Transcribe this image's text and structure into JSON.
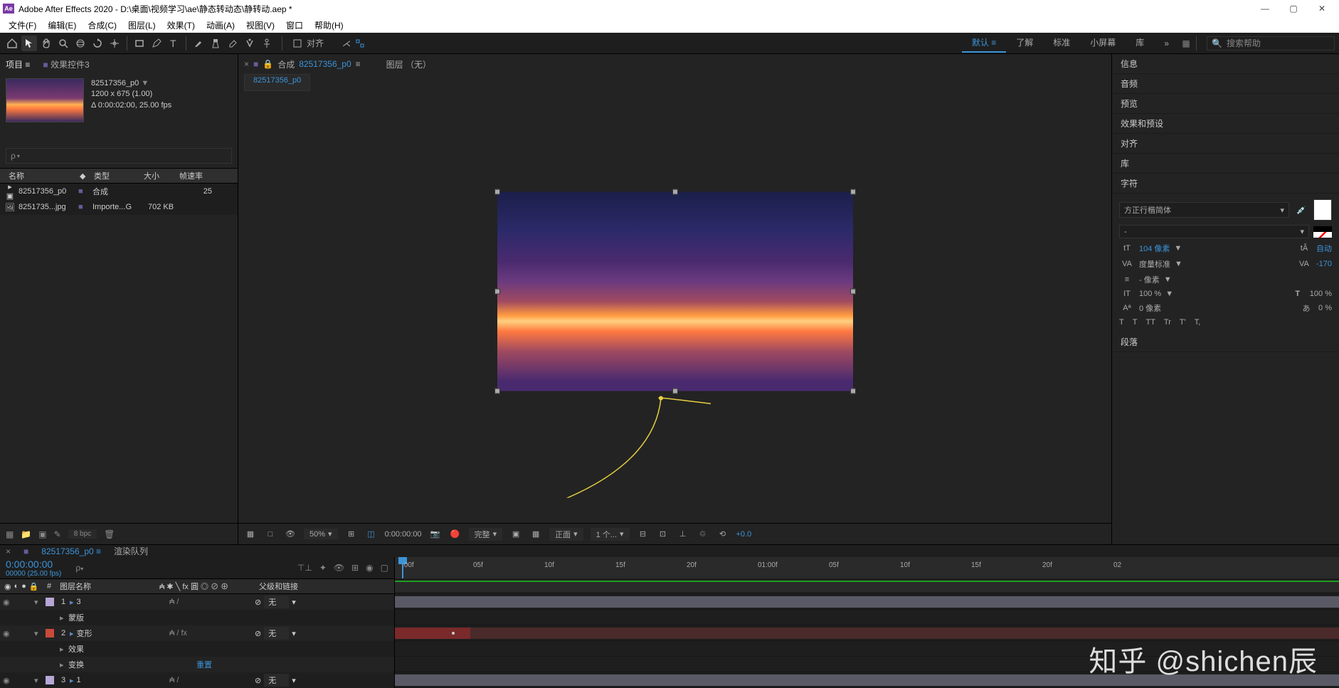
{
  "titlebar": {
    "logo": "Ae",
    "title": "Adobe After Effects 2020 - D:\\桌面\\视频学习\\ae\\静态转动态\\静转动.aep *"
  },
  "menubar": [
    "文件(F)",
    "编辑(E)",
    "合成(C)",
    "图层(L)",
    "效果(T)",
    "动画(A)",
    "视图(V)",
    "窗口",
    "帮助(H)"
  ],
  "toolbar": {
    "align_label": "对齐"
  },
  "workspaces": {
    "items": [
      "默认",
      "了解",
      "标准",
      "小屏幕",
      "库"
    ],
    "active": "默认",
    "more": "»",
    "search_placeholder": "搜索帮助"
  },
  "project": {
    "tab_project": "项目",
    "tab_effects": "效果控件3",
    "menu_glyph": "≡",
    "link_glyph": "■",
    "selected": {
      "name": "82517356_p0",
      "dims": "1200 x 675 (1.00)",
      "duration": "Δ 0:00:02:00, 25.00 fps"
    },
    "columns": {
      "name": "名称",
      "tag": "◆",
      "type": "类型",
      "size": "大小",
      "fps": "帧速率"
    },
    "rows": [
      {
        "name": "82517356_p0",
        "type": "合成",
        "size": "",
        "fps": "25"
      },
      {
        "name": "8251735...jpg",
        "type": "Importe...G",
        "size": "702 KB",
        "fps": ""
      }
    ],
    "footer": {
      "bpc": "8 bpc"
    }
  },
  "composition": {
    "tab_prefix": "合成",
    "tab_name": "82517356_p0",
    "menu_glyph": "≡",
    "layer_none": "图层 （无）",
    "subtab": "82517356_p0"
  },
  "viewer_footer": {
    "zoom": "50%",
    "timecode": "0:00:00:00",
    "res": "完整",
    "view": "正面",
    "views": "1 个...",
    "exposure": "+0.0"
  },
  "right": {
    "panels": [
      "信息",
      "音频",
      "预览",
      "效果和预设",
      "对齐",
      "库",
      "字符",
      "段落"
    ],
    "char": {
      "font": "方正行楷简体",
      "style": "-",
      "size_ic": "tT",
      "size": "104 像素",
      "size_arrow": "▼",
      "leading_ic": "tÂ",
      "leading": "自动",
      "kerning_ic": "VA",
      "kerning": "度量标准",
      "kerning_arrow": "▼",
      "tracking_ic": "VA",
      "tracking": "-170",
      "stroke_ic": "≡",
      "stroke": "- 像素",
      "stroke_arrow": "▼",
      "vscale_ic": "IT",
      "vscale": "100 %",
      "vscale_arrow": "▼",
      "hscale_ic": "T",
      "hscale": "100 %",
      "baseline_ic": "Aª",
      "baseline": "0 像素",
      "tsume_ic": "あ",
      "tsume": "0 %",
      "styles": [
        "T",
        "T",
        "TT",
        "Tr",
        "T'",
        "T,"
      ]
    }
  },
  "timeline": {
    "tabs": {
      "comp": "82517356_p0",
      "render": "渲染队列"
    },
    "timecode": "0:00:00:00",
    "fps_label": "00000 (25.00 fps)",
    "head": {
      "layer_name": "图层名称",
      "modes": "₳ ✱ ╲ fx 圓 ◎ ⊘ ⊕",
      "parent": "父级和链接"
    },
    "layers": [
      {
        "num": "1",
        "color": "#b8a6d6",
        "name": "3",
        "mode": "₳   /",
        "parent": "无"
      },
      {
        "sub": true,
        "name": "蒙版"
      },
      {
        "num": "2",
        "color": "#c94a3b",
        "name": "变形",
        "mode": "₳   / fx",
        "parent": "无"
      },
      {
        "sub": true,
        "name": "效果"
      },
      {
        "sub": true,
        "name": "变换",
        "reset": "重置"
      },
      {
        "num": "3",
        "color": "#b8a6d6",
        "name": "1",
        "mode": "₳   /",
        "parent": "无"
      }
    ],
    "ruler_ticks": [
      ":00f",
      "05f",
      "10f",
      "15f",
      "20f",
      "01:00f",
      "05f",
      "10f",
      "15f",
      "20f",
      "02"
    ]
  },
  "watermark": "知乎 @shichen辰"
}
